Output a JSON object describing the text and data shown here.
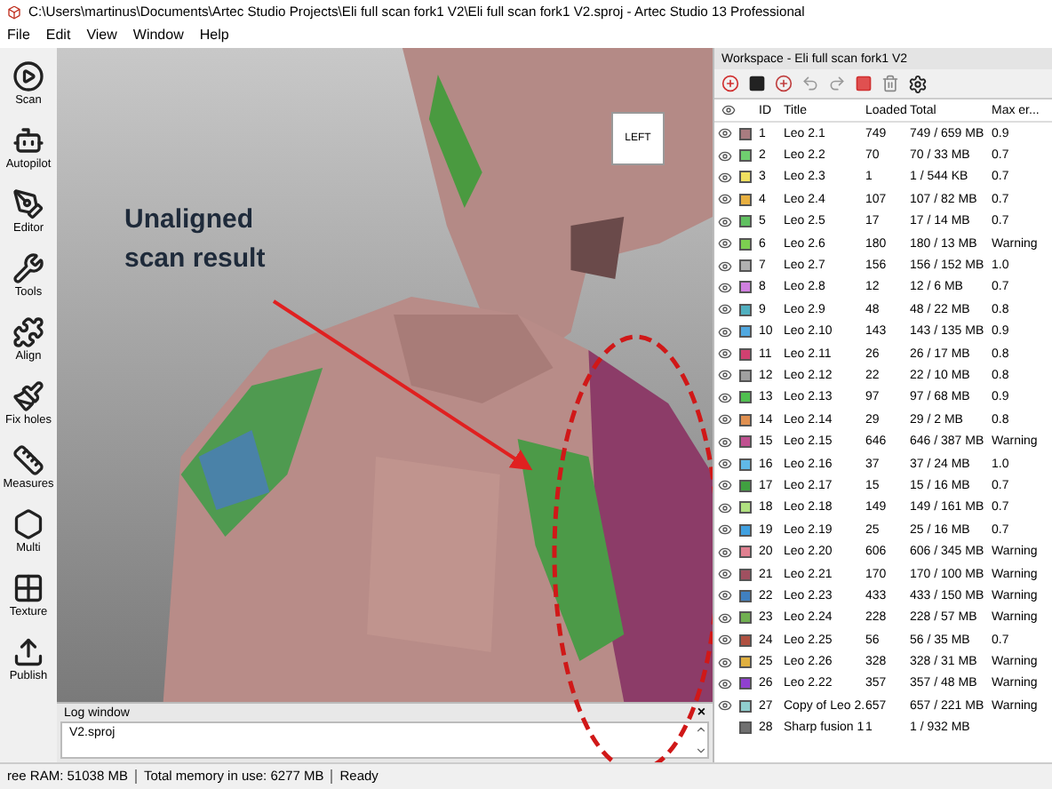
{
  "window": {
    "title": "C:\\Users\\martinus\\Documents\\Artec Studio Projects\\Eli full scan fork1 V2\\Eli full scan fork1 V2.sproj - Artec Studio 13 Professional"
  },
  "menu": [
    "File",
    "Edit",
    "View",
    "Window",
    "Help"
  ],
  "tools": [
    {
      "label": "Scan",
      "kind": "scan"
    },
    {
      "label": "Autopilot",
      "kind": "autopilot"
    },
    {
      "label": "Editor",
      "kind": "editor"
    },
    {
      "label": "Tools",
      "kind": "tools"
    },
    {
      "label": "Align",
      "kind": "align"
    },
    {
      "label": "Fix holes",
      "kind": "fix"
    },
    {
      "label": "Measures",
      "kind": "measures"
    },
    {
      "label": "Multi",
      "kind": "multi"
    },
    {
      "label": "Texture",
      "kind": "texture"
    },
    {
      "label": "Publish",
      "kind": "publish"
    }
  ],
  "viewport": {
    "kind": "picture",
    "cube_label": "LEFT",
    "annotation": "Unaligned scan result"
  },
  "log_window": {
    "title": "Log window",
    "close": "×",
    "text": "V2.sproj"
  },
  "workspace": {
    "title": "Workspace - Eli full scan fork1 V2",
    "table": {
      "columns": [
        "ID",
        "Title",
        "Loaded",
        "Total",
        "Max er..."
      ],
      "rows": [
        {
          "visible": true,
          "color": "#a87c80",
          "id": "1",
          "title": "Leo 2.1",
          "loaded": "749",
          "total": "749 / 659 MB",
          "max_error": "0.9"
        },
        {
          "visible": true,
          "color": "#6fcf6f",
          "id": "2",
          "title": "Leo 2.2",
          "loaded": "70",
          "total": "70 / 33 MB",
          "max_error": "0.7"
        },
        {
          "visible": true,
          "color": "#f0e060",
          "id": "3",
          "title": "Leo 2.3",
          "loaded": "1",
          "total": "1 / 544 KB",
          "max_error": "0.7"
        },
        {
          "visible": true,
          "color": "#e8b040",
          "id": "4",
          "title": "Leo 2.4",
          "loaded": "107",
          "total": "107 / 82 MB",
          "max_error": "0.7"
        },
        {
          "visible": true,
          "color": "#60c060",
          "id": "5",
          "title": "Leo 2.5",
          "loaded": "17",
          "total": "17 / 14 MB",
          "max_error": "0.7"
        },
        {
          "visible": true,
          "color": "#7ccf50",
          "id": "6",
          "title": "Leo 2.6",
          "loaded": "180",
          "total": "180 / 13 MB",
          "max_error": "Warning"
        },
        {
          "visible": true,
          "color": "#b0b0b0",
          "id": "7",
          "title": "Leo 2.7",
          "loaded": "156",
          "total": "156 / 152 MB",
          "max_error": "1.0"
        },
        {
          "visible": true,
          "color": "#d080e0",
          "id": "8",
          "title": "Leo 2.8",
          "loaded": "12",
          "total": "12 / 6 MB",
          "max_error": "0.7"
        },
        {
          "visible": true,
          "color": "#50b0c0",
          "id": "9",
          "title": "Leo 2.9",
          "loaded": "48",
          "total": "48 / 22 MB",
          "max_error": "0.8"
        },
        {
          "visible": true,
          "color": "#50a8e0",
          "id": "10",
          "title": "Leo 2.10",
          "loaded": "143",
          "total": "143 / 135 MB",
          "max_error": "0.9"
        },
        {
          "visible": true,
          "color": "#d04070",
          "id": "11",
          "title": "Leo 2.11",
          "loaded": "26",
          "total": "26 / 17 MB",
          "max_error": "0.8"
        },
        {
          "visible": true,
          "color": "#a0a0a0",
          "id": "12",
          "title": "Leo 2.12",
          "loaded": "22",
          "total": "22 / 10 MB",
          "max_error": "0.8"
        },
        {
          "visible": true,
          "color": "#50c050",
          "id": "13",
          "title": "Leo 2.13",
          "loaded": "97",
          "total": "97 / 68 MB",
          "max_error": "0.9"
        },
        {
          "visible": true,
          "color": "#e09050",
          "id": "14",
          "title": "Leo 2.14",
          "loaded": "29",
          "total": "29 / 2 MB",
          "max_error": "0.8"
        },
        {
          "visible": true,
          "color": "#c05090",
          "id": "15",
          "title": "Leo 2.15",
          "loaded": "646",
          "total": "646 / 387 MB",
          "max_error": "Warning"
        },
        {
          "visible": true,
          "color": "#60b8e8",
          "id": "16",
          "title": "Leo 2.16",
          "loaded": "37",
          "total": "37 / 24 MB",
          "max_error": "1.0"
        },
        {
          "visible": true,
          "color": "#40a040",
          "id": "17",
          "title": "Leo 2.17",
          "loaded": "15",
          "total": "15 / 16 MB",
          "max_error": "0.7"
        },
        {
          "visible": true,
          "color": "#b0e080",
          "id": "18",
          "title": "Leo 2.18",
          "loaded": "149",
          "total": "149 / 161 MB",
          "max_error": "0.7"
        },
        {
          "visible": true,
          "color": "#40a0e0",
          "id": "19",
          "title": "Leo 2.19",
          "loaded": "25",
          "total": "25 / 16 MB",
          "max_error": "0.7"
        },
        {
          "visible": true,
          "color": "#e08090",
          "id": "20",
          "title": "Leo 2.20",
          "loaded": "606",
          "total": "606 / 345 MB",
          "max_error": "Warning"
        },
        {
          "visible": true,
          "color": "#a05060",
          "id": "21",
          "title": "Leo 2.21",
          "loaded": "170",
          "total": "170 / 100 MB",
          "max_error": "Warning"
        },
        {
          "visible": true,
          "color": "#4080c0",
          "id": "22",
          "title": "Leo 2.23",
          "loaded": "433",
          "total": "433 / 150 MB",
          "max_error": "Warning"
        },
        {
          "visible": true,
          "color": "#70b050",
          "id": "23",
          "title": "Leo 2.24",
          "loaded": "228",
          "total": "228 / 57 MB",
          "max_error": "Warning"
        },
        {
          "visible": true,
          "color": "#b05040",
          "id": "24",
          "title": "Leo 2.25",
          "loaded": "56",
          "total": "56 / 35 MB",
          "max_error": "0.7"
        },
        {
          "visible": true,
          "color": "#e0b040",
          "id": "25",
          "title": "Leo 2.26",
          "loaded": "328",
          "total": "328 / 31 MB",
          "max_error": "Warning"
        },
        {
          "visible": true,
          "color": "#9040d0",
          "id": "26",
          "title": "Leo 2.22",
          "loaded": "357",
          "total": "357 / 48 MB",
          "max_error": "Warning"
        },
        {
          "visible": true,
          "color": "#90d0d0",
          "id": "27",
          "title": "Copy of Leo 2.",
          "loaded": "657",
          "total": "657 / 221 MB",
          "max_error": "Warning"
        },
        {
          "visible": false,
          "color": "#707070",
          "id": "28",
          "title": "Sharp fusion 1",
          "loaded": "1",
          "total": "1 / 932 MB",
          "max_error": ""
        }
      ]
    }
  },
  "status_bar": [
    "ree RAM: 51038 MB",
    "Total memory in use: 6277 MB",
    "Ready"
  ]
}
